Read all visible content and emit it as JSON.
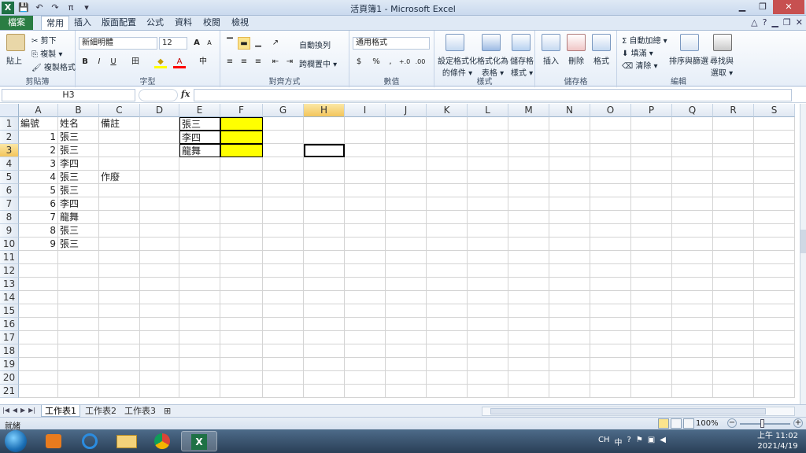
{
  "window": {
    "title": "活頁簿1 - Microsoft Excel",
    "app_icon": "X"
  },
  "qat": [
    "💾",
    "↶",
    "↷",
    "π",
    "▾"
  ],
  "tabs": [
    "檔案",
    "常用",
    "插入",
    "版面配置",
    "公式",
    "資料",
    "校閱",
    "檢視"
  ],
  "ribbon": {
    "clipboard": {
      "paste": "貼上",
      "cut": "剪下",
      "copy": "複製 ▾",
      "format_painter": "複製格式",
      "name": "剪貼簿"
    },
    "font": {
      "family": "新細明體",
      "size": "12",
      "grow": "A",
      "shrink": "A",
      "bold": "B",
      "italic": "I",
      "underline": "U",
      "border": "田",
      "fill": "◆",
      "color": "A",
      "phonetic": "中",
      "name": "字型"
    },
    "alignment": {
      "wrap": "自動換列",
      "merge": "跨欄置中 ▾",
      "name": "對齊方式"
    },
    "number": {
      "format": "通用格式",
      "currency": "$",
      "percent": "%",
      "comma": ",",
      "inc": "+.0",
      "dec": ".00",
      "name": "數值"
    },
    "styles": {
      "cond": "設定格式化的條件",
      "cond1": "設定格式化",
      "cond2": "的條件 ▾",
      "table1": "格式化為",
      "table2": "表格 ▾",
      "cell1": "儲存格",
      "cell2": "樣式 ▾",
      "name": "樣式"
    },
    "cells": {
      "insert": "插入",
      "delete": "刪除",
      "format": "格式",
      "name": "儲存格"
    },
    "editing": {
      "autosum": "Σ 自動加總 ▾",
      "fill": "填滿 ▾",
      "clear": "清除 ▾",
      "sort1": "排序與篩選",
      "find1": "尋找與",
      "find2": "選取 ▾",
      "name": "編輯"
    }
  },
  "formula_bar": {
    "name_box": "H3",
    "fx": "fx",
    "content": ""
  },
  "columns": [
    "A",
    "B",
    "C",
    "D",
    "E",
    "F",
    "G",
    "H",
    "I",
    "J",
    "K",
    "L",
    "M",
    "N",
    "O",
    "P",
    "Q",
    "R",
    "S"
  ],
  "rows": [
    "1",
    "2",
    "3",
    "4",
    "5",
    "6",
    "7",
    "8",
    "9",
    "10",
    "11",
    "12",
    "13",
    "14",
    "15",
    "16",
    "17",
    "18",
    "19",
    "20",
    "21"
  ],
  "cells": {
    "A1": "編號",
    "B1": "姓名",
    "C1": "備註",
    "A2": "1",
    "B2": "張三",
    "A3": "2",
    "B3": "張三",
    "A4": "3",
    "B4": "李四",
    "A5": "4",
    "B5": "張三",
    "C5": "作廢",
    "A6": "5",
    "B6": "張三",
    "A7": "6",
    "B7": "李四",
    "A8": "7",
    "B8": "龍舞",
    "A9": "8",
    "B9": "張三",
    "A10": "9",
    "B10": "張三",
    "E1": "張三",
    "E2": "李四",
    "E3": "龍舞"
  },
  "active_cell": "H3",
  "sheets": [
    "工作表1",
    "工作表2",
    "工作表3"
  ],
  "status": {
    "ready": "就緒",
    "zoom": "100%"
  },
  "taskbar": {
    "lang": "CH",
    "ime": "中",
    "time": "上午 11:02",
    "date": "2021/4/19"
  },
  "colors": {
    "fill_yellow": "#ffff00",
    "excel_green": "#2a7d43",
    "selection": "#f3c55b"
  }
}
